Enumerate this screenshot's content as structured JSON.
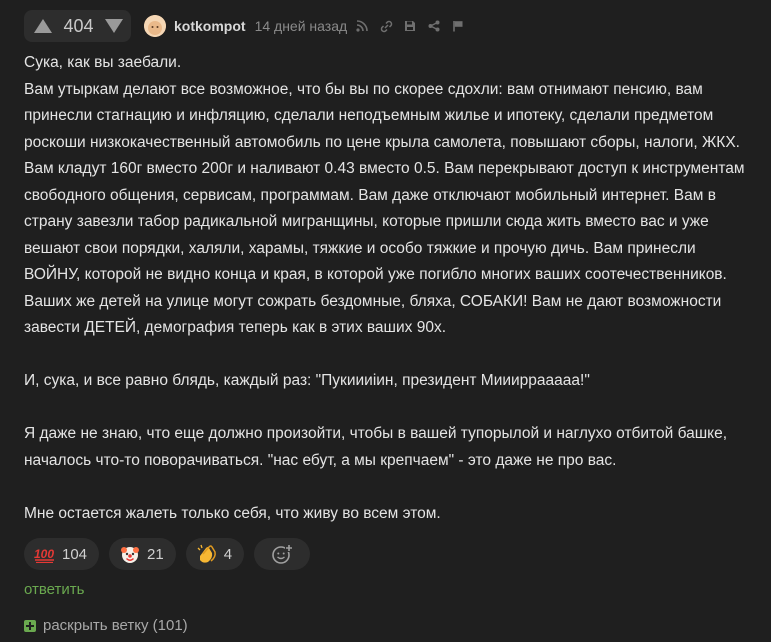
{
  "header": {
    "rating": "404",
    "author": "kotkompot",
    "time": "14 дней назад",
    "icons": [
      "rss-icon",
      "link-icon",
      "save-icon",
      "share-icon",
      "flag-icon"
    ]
  },
  "body": {
    "paragraphs": [
      "Сука, как вы заебали.",
      "Вам утыркам делают все возможное, что бы вы по скорее сдохли: вам отнимают пенсию, вам принесли стагнацию и инфляцию, сделали неподъемным жилье и ипотеку, сделали предметом роскоши низкокачественный автомобиль по цене крыла самолета, повышают сборы, налоги, ЖКХ. Вам кладут 160г вместо 200г и наливают 0.43 вместо 0.5. Вам перекрывают доступ к инструментам свободного общения, сервисам, программам. Вам даже отключают мобильный интернет. Вам в страну завезли табор радикальной мигранщины, которые пришли сюда жить вместо вас и уже вешают свои порядки, халяли, харамы, тяжкие и особо тяжкие и прочую дичь. Вам принесли ВОЙНУ, которой не видно конца и края, в которой уже погибло многих ваших соотечественников. Ваших же детей на улице могут сожрать бездомные, бляха, СОБАКИ! Вам не дают возможности завести ДЕТЕЙ, демография теперь как в этих ваших 90х.",
      "И, сука, и все равно блядь, каждый раз: \"Пукиииiин, президент Миииррааааа!\"",
      "Я даже не знаю, что еще должно произойти, чтобы в вашей тупорылой и наглухо отбитой башке, началось что-то поворачиваться. \"нас ебут, а мы крепчаем\" - это даже не про вас.",
      "Мне остается жалеть только себя, что живу во всем этом."
    ]
  },
  "reactions": [
    {
      "icon": "hundred-points-icon",
      "count": "104"
    },
    {
      "icon": "clown-face-icon",
      "count": "21"
    },
    {
      "icon": "clapping-hands-icon",
      "count": "4"
    }
  ],
  "actions": {
    "reply": "ответить",
    "expand": "раскрыть ветку (101)"
  },
  "colors": {
    "background": "#1f1f1f",
    "accent_green": "#6aa84f",
    "chip": "#2d2d2d"
  }
}
